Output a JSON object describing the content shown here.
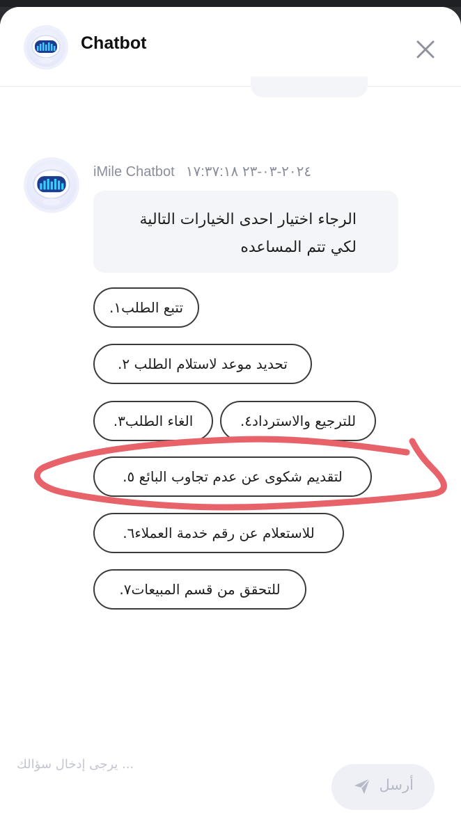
{
  "header": {
    "title": "Chatbot",
    "avatar_icon": "robot-icon",
    "close_icon": "close-icon"
  },
  "message": {
    "sender": "iMile Chatbot",
    "timestamp": "٢٠٢٤-٠٣-٢٣ ١٧:٣٧:١٨",
    "lines": [
      "الرجاء اختيار احدى الخيارات التالية",
      "لكي تتم المساعده"
    ]
  },
  "options": [
    {
      "label": "تتبع الطلب١."
    },
    {
      "label": "تحديد موعد لاستلام الطلب ٢."
    },
    {
      "label": "الغاء الطلب٣."
    },
    {
      "label": "للترجيع والاسترداد٤."
    },
    {
      "label": "لتقديم شكوى عن عدم تجاوب البائع ٥."
    },
    {
      "label": "للاستعلام عن رقم خدمة العملاء٦."
    },
    {
      "label": "للتحقق من قسم المبيعات٧."
    }
  ],
  "input": {
    "placeholder": "... يرجى إدخال سؤالك",
    "value": ""
  },
  "send_button": {
    "label": "أرسل",
    "icon": "send-icon"
  },
  "colors": {
    "annotation": "#e8626a",
    "bubble": "#f4f5f9",
    "title": "#111111",
    "meta": "#8a8d9c"
  }
}
